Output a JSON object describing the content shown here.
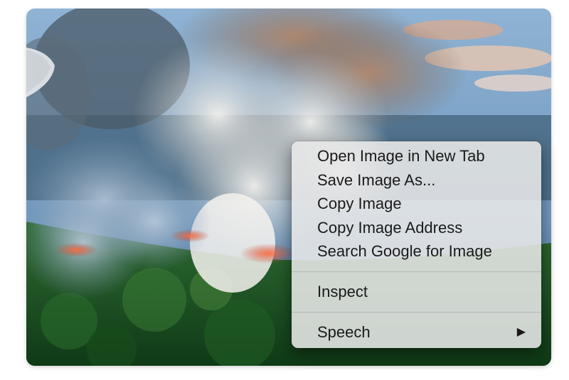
{
  "image": {
    "subject": "aerial-forest-fire-photo"
  },
  "context_menu": {
    "items": [
      {
        "label": "Open Image in New Tab"
      },
      {
        "label": "Save Image As..."
      },
      {
        "label": "Copy Image"
      },
      {
        "label": "Copy Image Address"
      },
      {
        "label": "Search Google for Image"
      }
    ],
    "inspect_label": "Inspect",
    "speech_label": "Speech",
    "submenu_icon": "triangle-right-icon"
  },
  "colors": {
    "menu_bg": "#e8e8e8",
    "menu_text": "#1a1a1a",
    "forest": "#1f5a24",
    "smoke": "#cfcfcf",
    "sky": "#7fa9cf"
  }
}
